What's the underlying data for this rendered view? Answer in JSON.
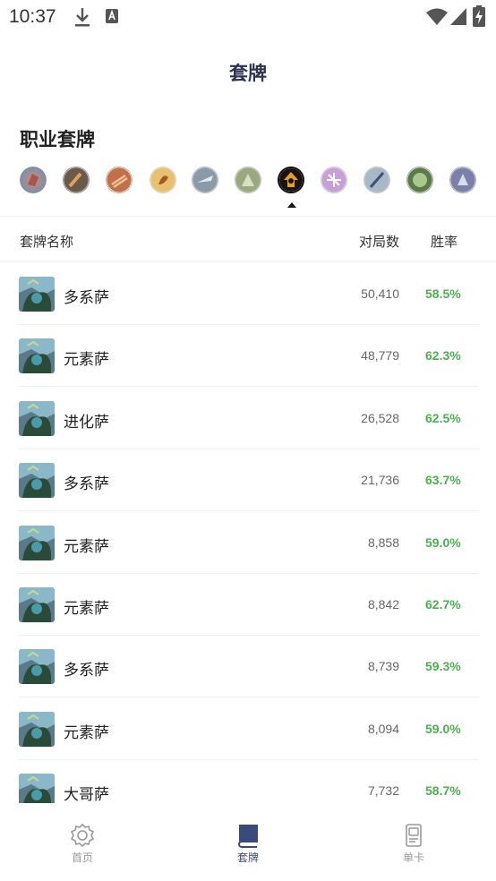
{
  "status": {
    "time": "10:37",
    "icons": [
      "download-icon",
      "a-notification-icon",
      "wifi-icon",
      "signal-icon",
      "battery-charging-icon"
    ]
  },
  "page_title": "套牌",
  "section_title": "职业套牌",
  "class_icons": [
    {
      "name": "class-icon-1"
    },
    {
      "name": "class-icon-2"
    },
    {
      "name": "class-icon-3"
    },
    {
      "name": "class-icon-4"
    },
    {
      "name": "class-icon-5"
    },
    {
      "name": "class-icon-6"
    },
    {
      "name": "class-icon-7-selected"
    },
    {
      "name": "class-icon-8"
    },
    {
      "name": "class-icon-9"
    },
    {
      "name": "class-icon-10"
    },
    {
      "name": "class-icon-11"
    }
  ],
  "table": {
    "headers": {
      "name": "套牌名称",
      "games": "对局数",
      "winrate": "胜率"
    },
    "rows": [
      {
        "name": "多系萨",
        "games": "50,410",
        "winrate": "58.5%"
      },
      {
        "name": "元素萨",
        "games": "48,779",
        "winrate": "62.3%"
      },
      {
        "name": "进化萨",
        "games": "26,528",
        "winrate": "62.5%"
      },
      {
        "name": "多系萨",
        "games": "21,736",
        "winrate": "63.7%"
      },
      {
        "name": "元素萨",
        "games": "8,858",
        "winrate": "59.0%"
      },
      {
        "name": "元素萨",
        "games": "8,842",
        "winrate": "62.7%"
      },
      {
        "name": "多系萨",
        "games": "8,739",
        "winrate": "59.3%"
      },
      {
        "name": "元素萨",
        "games": "8,094",
        "winrate": "59.0%"
      },
      {
        "name": "大哥萨",
        "games": "7,732",
        "winrate": "58.7%"
      }
    ]
  },
  "colors": {
    "winrate": "#4caf50",
    "title": "#2b3350",
    "nav_active": "#3a4a7a",
    "nav_inactive": "#999999"
  },
  "nav": {
    "home": {
      "label": "首页",
      "icon": "home-gear-icon"
    },
    "decks": {
      "label": "套牌",
      "icon": "book-icon"
    },
    "cards": {
      "label": "单卡",
      "icon": "card-icon"
    }
  }
}
